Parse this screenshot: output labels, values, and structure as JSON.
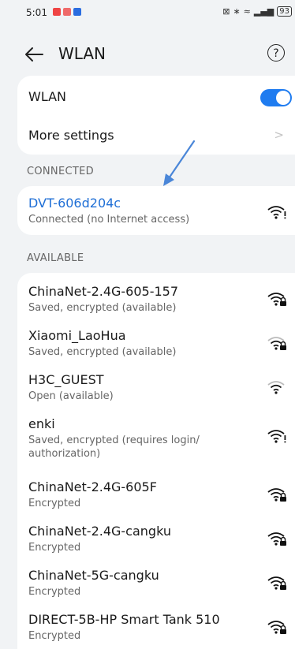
{
  "status_bar": {
    "time": "5:01",
    "notification_colors": [
      "#ef4444",
      "#ef4444",
      "#2b6de0"
    ],
    "battery": "93"
  },
  "header": {
    "title": "WLAN",
    "help": "?"
  },
  "wlan_card": {
    "wlan_label": "WLAN",
    "wlan_enabled": true,
    "more_settings_label": "More settings"
  },
  "connected": {
    "section_title": "CONNECTED",
    "network": {
      "ssid": "DVT-606d204c",
      "status": "Connected (no Internet access)",
      "icon": "wifi-warning-icon"
    }
  },
  "available": {
    "section_title": "AVAILABLE",
    "networks": [
      {
        "ssid": "ChinaNet-2.4G-605-157",
        "status": "Saved, encrypted (available)",
        "icon": "wifi-lock-icon"
      },
      {
        "ssid": "Xiaomi_LaoHua",
        "status": "Saved, encrypted (available)",
        "icon": "wifi-lock-weak-icon"
      },
      {
        "ssid": "H3C_GUEST",
        "status": "Open (available)",
        "icon": "wifi-weak-icon"
      },
      {
        "ssid": "enki",
        "status": "Saved, encrypted (requires login/ authorization)",
        "icon": "wifi-warning-icon"
      },
      {
        "ssid": "ChinaNet-2.4G-605F",
        "status": "Encrypted",
        "icon": "wifi-lock-icon"
      },
      {
        "ssid": "ChinaNet-2.4G-cangku",
        "status": "Encrypted",
        "icon": "wifi-lock-icon"
      },
      {
        "ssid": "ChinaNet-5G-cangku",
        "status": "Encrypted",
        "icon": "wifi-lock-icon"
      },
      {
        "ssid": "DIRECT-5B-HP Smart Tank 510",
        "status": "Encrypted",
        "icon": "wifi-lock-icon"
      }
    ]
  },
  "colors": {
    "accent": "#1f7cf0",
    "connected_text": "#1f6fd6",
    "annotation_arrow": "#4a86d8"
  }
}
